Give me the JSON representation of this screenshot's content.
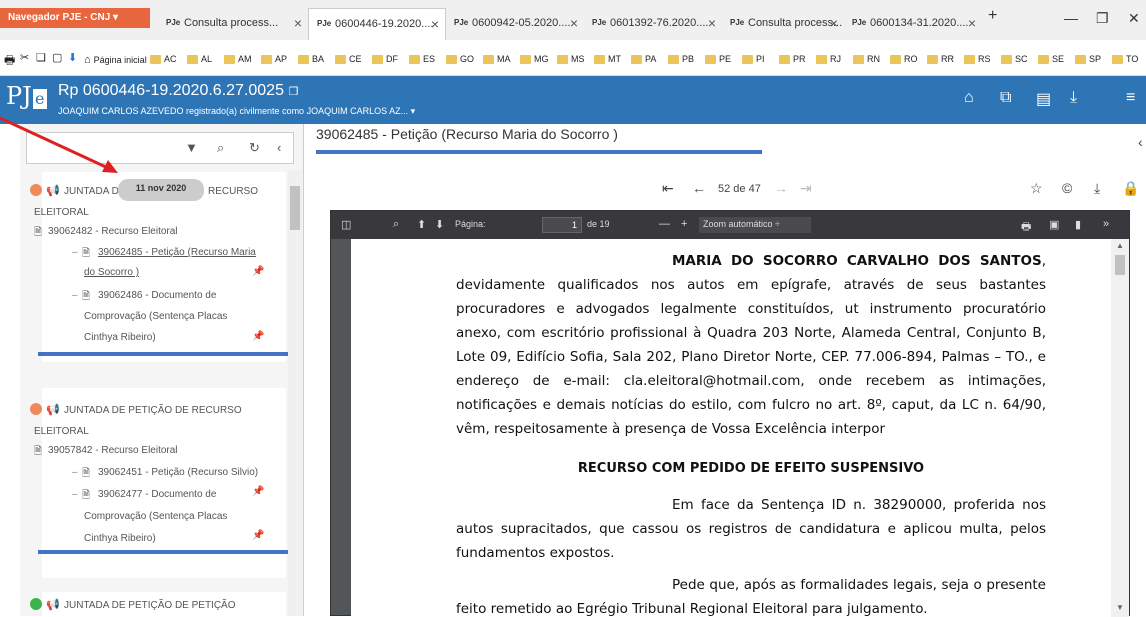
{
  "browser": {
    "nav_menu": "Navegador PJE - CNJ ▾",
    "tabs": [
      {
        "label": "Consulta process..."
      },
      {
        "label": "0600446-19.2020...."
      },
      {
        "label": "0600942-05.2020...."
      },
      {
        "label": "0601392-76.2020...."
      },
      {
        "label": "Consulta process..."
      },
      {
        "label": "0600134-31.2020...."
      }
    ],
    "new_tab": "+",
    "tab_favicon": "PJe"
  },
  "favorites": {
    "home_label": "Página inicial",
    "folders": [
      "AC",
      "AL",
      "AM",
      "AP",
      "BA",
      "CE",
      "DF",
      "ES",
      "GO",
      "MA",
      "MG",
      "MS",
      "MT",
      "PA",
      "PB",
      "PE",
      "PI",
      "PR",
      "RJ",
      "RN",
      "RO",
      "RR",
      "RS",
      "SC",
      "SE",
      "SP",
      "TO"
    ]
  },
  "header": {
    "logo": "PJ",
    "logo_e": "e",
    "process_number": "Rp 0600446-19.2020.6.27.0025",
    "parties": "JOAQUIM CARLOS AZEVEDO registrado(a) civilmente como JOAQUIM CARLOS AZ..."
  },
  "timeline": {
    "tooltip_date": "11 nov 2020",
    "entries": [
      {
        "title_a": "JUNTADA D",
        "title_b": "RECURSO",
        "title_line2": "ELEITORAL",
        "parent_doc": "39062482 - Recurso Eleitoral",
        "child1_l1": "39062485 - Petição (Recurso Maria",
        "child1_l2": "do Socorro )",
        "child2_l1": "39062486 - Documento de",
        "child2_l2": "Comprovação (Sentença Placas",
        "child2_l3": "Cinthya Ribeiro)"
      },
      {
        "title_line1": "JUNTADA DE PETIÇÃO DE RECURSO",
        "title_line2": "ELEITORAL",
        "parent_doc": "39057842 - Recurso Eleitoral",
        "child1_l1": "39062451 - Petição (Recurso Silvio)",
        "child2_l1": "39062477 - Documento de",
        "child2_l2": "Comprovação (Sentença Placas",
        "child2_l3": "Cinthya Ribeiro)"
      },
      {
        "title_line1": "JUNTADA DE PETIÇÃO DE PETIÇÃO"
      }
    ]
  },
  "document": {
    "title": "39062485 - Petição (Recurso Maria do Socorro )",
    "nav_position": "52 de 47"
  },
  "pdf": {
    "page_label": "Página:",
    "page_value": "1",
    "page_total": "de 19",
    "zoom": "Zoom automático",
    "para1_name": "MARIA DO SOCORRO CARVALHO DOS SANTOS",
    "para1": "devidamente qualificados nos autos em epígrafe, através de seus bastantes procuradores e advogados legalmente constituídos, ut instrumento procuratório anexo, com escritório profissional à Quadra 203 Norte, Alameda Central, Conjunto B, Lote 09, Edifício Sofia, Sala 202, Plano Diretor Norte, CEP. 77.006-894, Palmas – TO., e endereço de e-mail: cla.eleitoral@hotmail.com, onde recebem as intimações, notificações e demais notícias do estilo, com fulcro no art. 8º, caput, da LC n. 64/90, vêm, respeitosamente à presença de Vossa Excelência interpor",
    "heading": "RECURSO COM PEDIDO DE EFEITO SUSPENSIVO",
    "para2": "Em face da Sentença ID n. 38290000, proferida nos autos supracitados, que cassou os registros de candidatura e aplicou multa, pelos fundamentos expostos.",
    "para3": "Pede que, após as formalidades legais, seja o presente feito remetido ao Egrégio Tribunal Regional Eleitoral para julgamento."
  },
  "colors": {
    "pje_blue": "#2e75b6",
    "nav_orange": "#e8663d",
    "dot_orange": "#f08a5d",
    "dot_green": "#3cb44b",
    "highlight_line": "#4472c4",
    "arrow": "#e02020"
  }
}
